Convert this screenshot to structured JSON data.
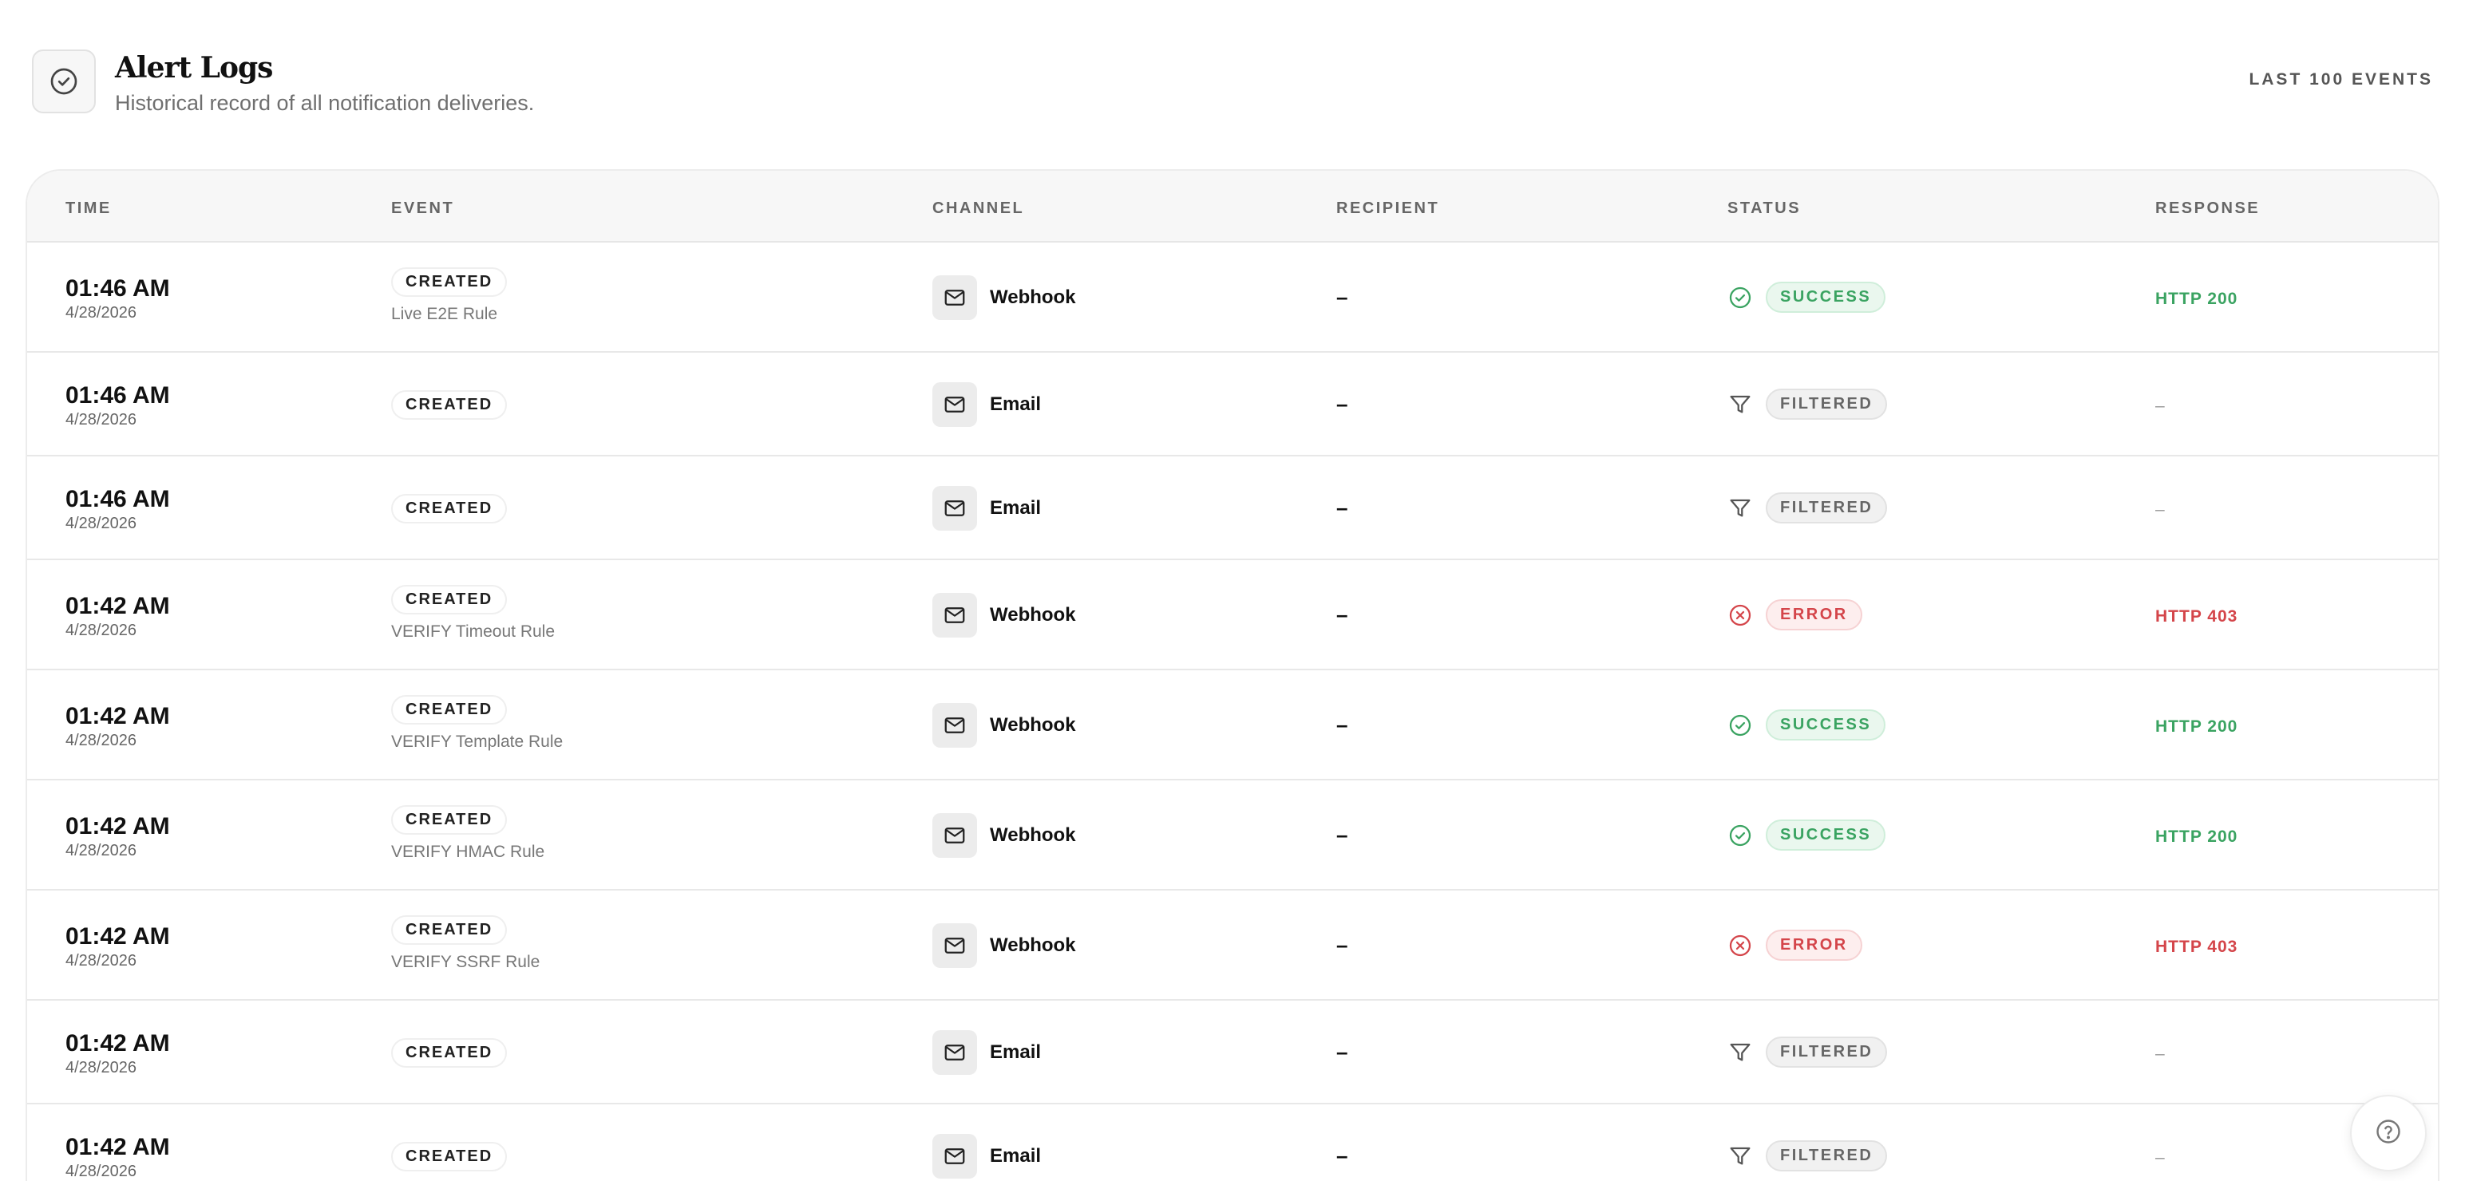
{
  "header": {
    "title": "Alert Logs",
    "subtitle": "Historical record of all notification deliveries.",
    "event_count": "LAST 100 EVENTS",
    "icon": "check-circle-icon"
  },
  "table": {
    "columns": [
      "TIME",
      "EVENT",
      "CHANNEL",
      "RECIPIENT",
      "STATUS",
      "RESPONSE"
    ],
    "rows": [
      {
        "time": "01:46 AM",
        "date": "4/28/2026",
        "event": "CREATED",
        "rule": "Live E2E Rule",
        "channel": "Webhook",
        "recipient": "–",
        "status": "SUCCESS",
        "response": "HTTP 200"
      },
      {
        "time": "01:46 AM",
        "date": "4/28/2026",
        "event": "CREATED",
        "rule": "",
        "channel": "Email",
        "recipient": "–",
        "status": "FILTERED",
        "response": "–"
      },
      {
        "time": "01:46 AM",
        "date": "4/28/2026",
        "event": "CREATED",
        "rule": "",
        "channel": "Email",
        "recipient": "–",
        "status": "FILTERED",
        "response": "–"
      },
      {
        "time": "01:42 AM",
        "date": "4/28/2026",
        "event": "CREATED",
        "rule": "VERIFY Timeout Rule",
        "channel": "Webhook",
        "recipient": "–",
        "status": "ERROR",
        "response": "HTTP 403"
      },
      {
        "time": "01:42 AM",
        "date": "4/28/2026",
        "event": "CREATED",
        "rule": "VERIFY Template Rule",
        "channel": "Webhook",
        "recipient": "–",
        "status": "SUCCESS",
        "response": "HTTP 200"
      },
      {
        "time": "01:42 AM",
        "date": "4/28/2026",
        "event": "CREATED",
        "rule": "VERIFY HMAC Rule",
        "channel": "Webhook",
        "recipient": "–",
        "status": "SUCCESS",
        "response": "HTTP 200"
      },
      {
        "time": "01:42 AM",
        "date": "4/28/2026",
        "event": "CREATED",
        "rule": "VERIFY SSRF Rule",
        "channel": "Webhook",
        "recipient": "–",
        "status": "ERROR",
        "response": "HTTP 403"
      },
      {
        "time": "01:42 AM",
        "date": "4/28/2026",
        "event": "CREATED",
        "rule": "",
        "channel": "Email",
        "recipient": "–",
        "status": "FILTERED",
        "response": "–"
      },
      {
        "time": "01:42 AM",
        "date": "4/28/2026",
        "event": "CREATED",
        "rule": "",
        "channel": "Email",
        "recipient": "–",
        "status": "FILTERED",
        "response": "–"
      }
    ]
  },
  "icons": {
    "channel": "mail-icon",
    "success": "check-circle-icon",
    "filtered": "filter-icon",
    "error": "x-circle-icon",
    "help": "help-circle-icon"
  },
  "colors": {
    "success": "#3aa361",
    "error": "#d4454a",
    "filtered": "#666666"
  }
}
